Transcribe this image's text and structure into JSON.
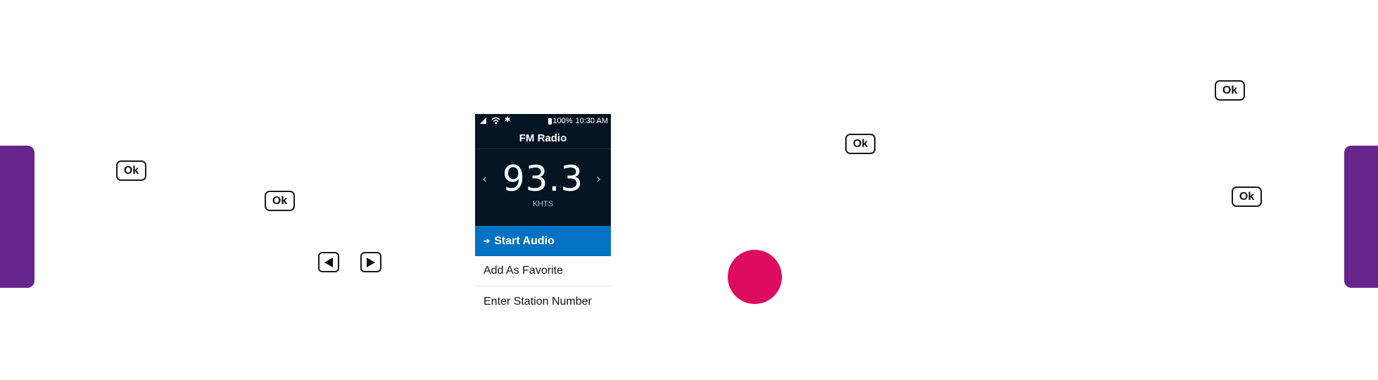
{
  "keys": {
    "ok": "Ok"
  },
  "phone": {
    "status": {
      "battery": "100%",
      "time": "10:30 AM"
    },
    "app_title": "FM Radio",
    "frequency": "93.3",
    "station": "KHTS",
    "prev_icon": "‹",
    "next_icon": "›",
    "menu": [
      {
        "label": "Start Audio",
        "selected": true
      },
      {
        "label": "Add As Favorite",
        "selected": false
      },
      {
        "label": "Enter Station Number",
        "selected": false
      }
    ]
  },
  "colors": {
    "tab": "#65258a",
    "screen_bg": "#031522",
    "selected_bg": "#0571c2",
    "dot": "#dc0b5d"
  }
}
